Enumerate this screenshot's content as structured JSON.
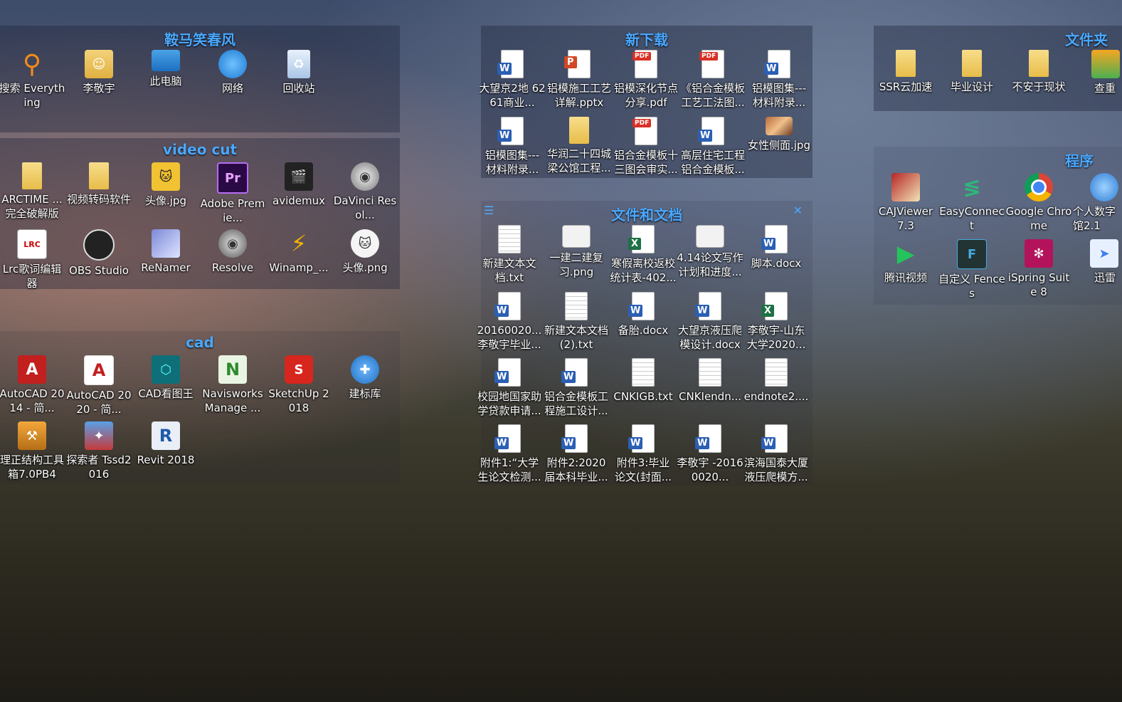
{
  "colors": {
    "fence_title": "#4aa8ff",
    "label": "#ffffff"
  },
  "fences": {
    "horse": {
      "title": "鞍马笑春风",
      "icons": [
        {
          "label": "搜索\nEverything",
          "icon": "search-icon"
        },
        {
          "label": "李敬宇",
          "icon": "user-folder-icon"
        },
        {
          "label": "此电脑",
          "icon": "computer-icon"
        },
        {
          "label": "网络",
          "icon": "network-icon"
        },
        {
          "label": "回收站",
          "icon": "recycle-bin-icon"
        }
      ]
    },
    "video": {
      "title": "video cut",
      "icons": [
        {
          "label": "ARCTIME ... 完全破解版",
          "icon": "folder-icon"
        },
        {
          "label": "视频转码软件",
          "icon": "folder-icon"
        },
        {
          "label": "头像.jpg",
          "icon": "image-icon"
        },
        {
          "label": "Adobe Premie...",
          "icon": "premiere-icon"
        },
        {
          "label": "avidemux",
          "icon": "clapper-icon"
        },
        {
          "label": "DaVinci Resol...",
          "icon": "davinci-icon"
        },
        {
          "label": "Lrc歌词编辑器",
          "icon": "lrc-icon"
        },
        {
          "label": "OBS Studio",
          "icon": "obs-icon"
        },
        {
          "label": "ReNamer",
          "icon": "renamer-icon"
        },
        {
          "label": "Resolve",
          "icon": "resolve-icon"
        },
        {
          "label": "Winamp_...",
          "icon": "winamp-icon"
        },
        {
          "label": "头像.png",
          "icon": "image-icon"
        }
      ]
    },
    "cad": {
      "title": "cad",
      "icons": [
        {
          "label": "AutoCAD 2014 - 简...",
          "icon": "autocad-icon"
        },
        {
          "label": "AutoCAD 2020 - 简...",
          "icon": "autocad-icon"
        },
        {
          "label": "CAD看图王",
          "icon": "cad-viewer-icon"
        },
        {
          "label": "Navisworks Manage ...",
          "icon": "navisworks-icon"
        },
        {
          "label": "SketchUp 2018",
          "icon": "sketchup-icon"
        },
        {
          "label": "建标库",
          "icon": "shield-icon"
        },
        {
          "label": "理正结构工具箱7.0PB4",
          "icon": "toolbox-icon"
        },
        {
          "label": "探索者 Tssd2016",
          "icon": "tssd-icon"
        },
        {
          "label": "Revit 2018",
          "icon": "revit-icon"
        }
      ]
    },
    "downloads": {
      "title": "新下载",
      "icons": [
        {
          "label": "大望京2地 6261商业...",
          "icon": "word-icon"
        },
        {
          "label": "铝模施工工艺 详解.pptx",
          "icon": "ppt-icon"
        },
        {
          "label": "铝模深化节点 分享.pdf",
          "icon": "pdf-icon"
        },
        {
          "label": "《铝合金模板 工艺工法图...",
          "icon": "pdf-icon"
        },
        {
          "label": "铝模图集--- 材料附录...",
          "icon": "word-icon"
        },
        {
          "label": "铝模图集--- 材料附录...",
          "icon": "word-icon"
        },
        {
          "label": "华润二十四城 梁公馆工程...",
          "icon": "folder-icon"
        },
        {
          "label": "铝合金模板十 三图会审实...",
          "icon": "pdf-icon"
        },
        {
          "label": "高层住宅工程 铝合金模板...",
          "icon": "word-icon"
        },
        {
          "label": "女性侧面.jpg",
          "icon": "photo-icon"
        }
      ]
    },
    "docs": {
      "title": "文件和文档",
      "icons": [
        {
          "label": "新建文本文 档.txt",
          "icon": "txt-icon"
        },
        {
          "label": "一建二建复 习.png",
          "icon": "png-icon"
        },
        {
          "label": "寒假离校返校 统计表-402...",
          "icon": "excel-icon"
        },
        {
          "label": "4.14论文写作 计划和进度...",
          "icon": "png-icon"
        },
        {
          "label": "脚本.docx",
          "icon": "word-icon"
        },
        {
          "label": "20160020... 李敬宇毕业...",
          "icon": "word-icon"
        },
        {
          "label": "新建文本文档 (2).txt",
          "icon": "txt-icon"
        },
        {
          "label": "备胎.docx",
          "icon": "word-icon"
        },
        {
          "label": "大望京液压爬 模设计.docx",
          "icon": "word-icon"
        },
        {
          "label": "李敬宇-山东 大学2020...",
          "icon": "excel-icon"
        },
        {
          "label": "校园地国家助 学贷款申请...",
          "icon": "word-icon"
        },
        {
          "label": "铝合金模板工 程施工设计...",
          "icon": "word-icon"
        },
        {
          "label": "CNKIGB.txt",
          "icon": "txt-icon"
        },
        {
          "label": "CNKIendn...",
          "icon": "txt-icon"
        },
        {
          "label": "endnote2....",
          "icon": "txt-icon"
        },
        {
          "label": "附件1:“大学 生论文检测...",
          "icon": "word-icon"
        },
        {
          "label": "附件2:2020 届本科毕业...",
          "icon": "word-icon"
        },
        {
          "label": "附件3:毕业 论文(封面...",
          "icon": "word-icon"
        },
        {
          "label": "李敬宇 -20160020...",
          "icon": "word-icon"
        },
        {
          "label": "滨海国泰大厦 液压爬模方...",
          "icon": "word-icon"
        }
      ]
    },
    "folders": {
      "title": "文件夹",
      "icons": [
        {
          "label": "SSR云加速",
          "icon": "folder-icon"
        },
        {
          "label": "毕业设计",
          "icon": "folder-icon"
        },
        {
          "label": "不安于现状",
          "icon": "folder-icon"
        },
        {
          "label": "查重",
          "icon": "folder-icon"
        }
      ]
    },
    "programs": {
      "title": "程序",
      "icons": [
        {
          "label": "CAJViewer 7.3",
          "icon": "cajviewer-icon"
        },
        {
          "label": "EasyConnect",
          "icon": "easyconnect-icon"
        },
        {
          "label": "Google Chrome",
          "icon": "chrome-icon"
        },
        {
          "label": "个人数字 馆2.1",
          "icon": "library-icon"
        },
        {
          "label": "腾讯视频",
          "icon": "tencent-video-icon"
        },
        {
          "label": "自定义 Fences",
          "icon": "fences-icon"
        },
        {
          "label": "iSpring Suite 8",
          "icon": "ispring-icon"
        },
        {
          "label": "迅雷",
          "icon": "thunder-icon"
        }
      ]
    }
  }
}
